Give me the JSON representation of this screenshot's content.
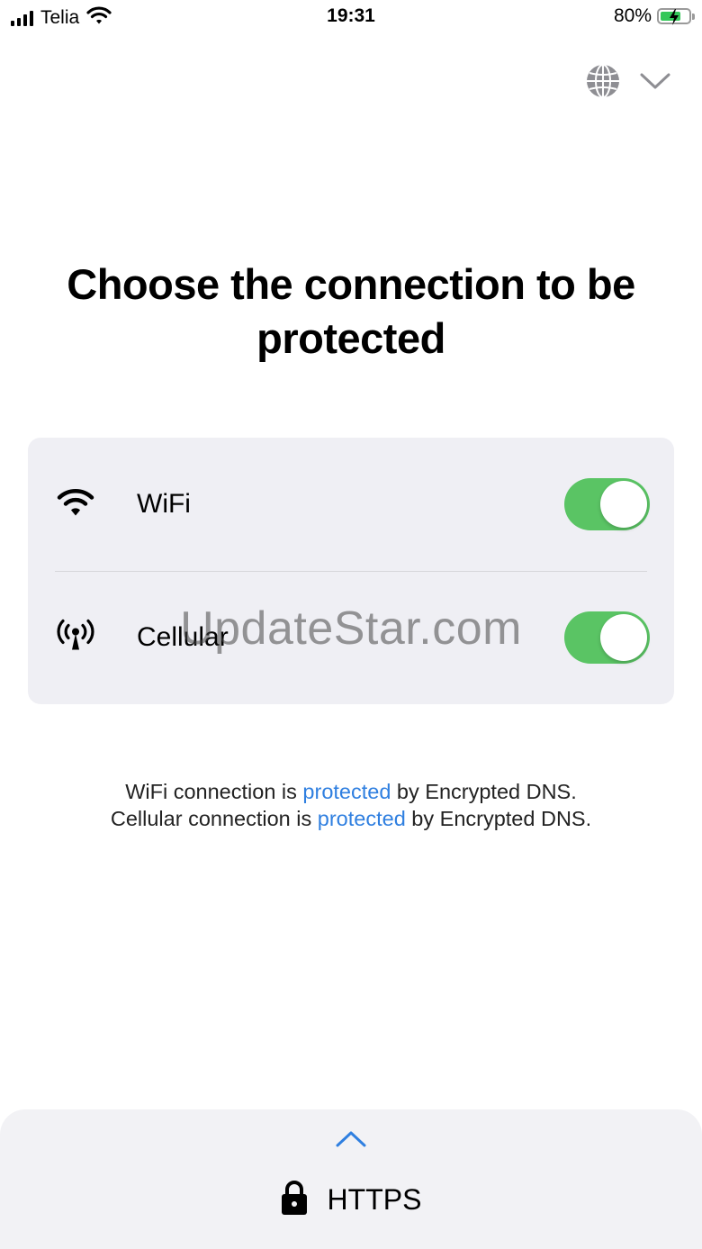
{
  "status_bar": {
    "carrier": "Telia",
    "time": "19:31",
    "battery_percent": "80%",
    "battery_level": 0.8,
    "icons": [
      "signal-icon",
      "wifi-icon",
      "battery-charging-icon"
    ]
  },
  "header": {
    "icons": [
      "globe-icon",
      "chevron-down-icon"
    ]
  },
  "main": {
    "title": "Choose the connection to be protected",
    "connections": [
      {
        "label": "WiFi",
        "icon": "wifi-icon",
        "enabled": true
      },
      {
        "label": "Cellular",
        "icon": "antenna-icon",
        "enabled": true
      }
    ],
    "status_line_1": {
      "prefix": "WiFi connection is ",
      "link": "protected",
      "suffix": " by Encrypted DNS."
    },
    "status_line_2": {
      "prefix": "Cellular connection is ",
      "link": "protected",
      "suffix": " by Encrypted DNS."
    }
  },
  "watermark": "UpdateStar.com",
  "bottom_sheet": {
    "protocol_label": "HTTPS",
    "icons": [
      "chevron-up-icon",
      "lock-icon"
    ]
  },
  "colors": {
    "toggle_on": "#5ac464",
    "link": "#2f7fe0",
    "card_bg": "#efeff4",
    "battery_fill": "#34c759"
  }
}
